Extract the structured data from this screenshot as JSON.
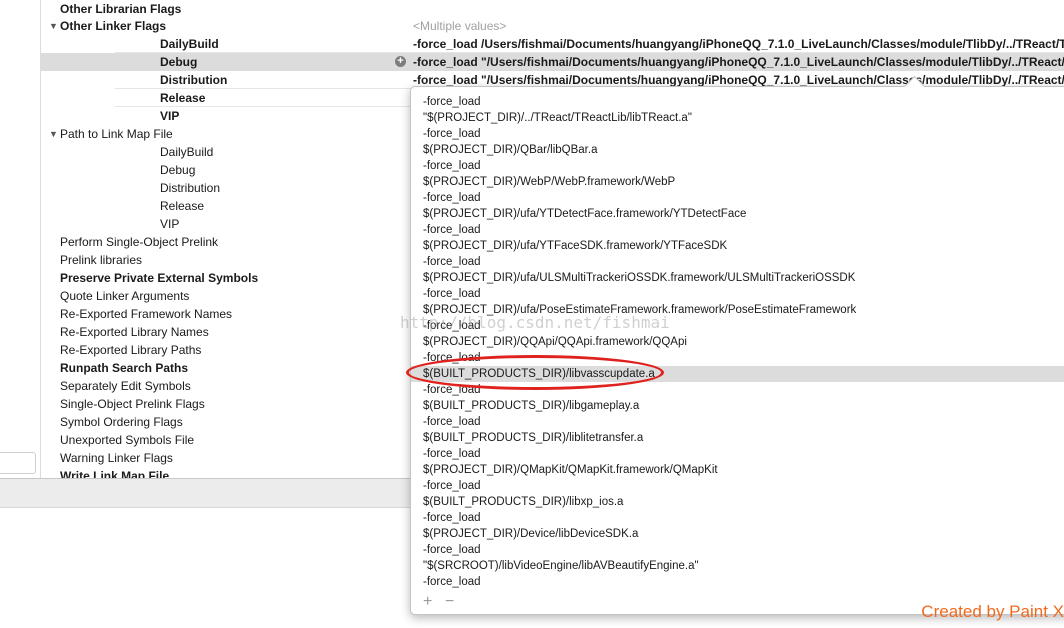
{
  "settings": {
    "other_librarian_flags": "Other Librarian Flags",
    "other_linker_flags": {
      "label": "Other Linker Flags",
      "value": "<Multiple values>",
      "configs": [
        {
          "name": "DailyBuild",
          "value": "-force_load /Users/fishmai/Documents/huangyang/iPhoneQQ_7.1.0_LiveLaunch/Classes/module/TlibDy/../TReact/TR"
        },
        {
          "name": "Debug",
          "value": "-force_load \"/Users/fishmai/Documents/huangyang/iPhoneQQ_7.1.0_LiveLaunch/Classes/module/TlibDy/../TReact/TR"
        },
        {
          "name": "Distribution",
          "value": "-force_load \"/Users/fishmai/Documents/huangyang/iPhoneQQ_7.1.0_LiveLaunch/Classes/module/TlibDy/../TReact/TR"
        },
        {
          "name": "Release",
          "value": ""
        },
        {
          "name": "VIP",
          "value": ""
        }
      ]
    },
    "path_to_link_map_file": {
      "label": "Path to Link Map File",
      "configs": [
        "DailyBuild",
        "Debug",
        "Distribution",
        "Release",
        "VIP"
      ]
    },
    "others": [
      {
        "label": "Perform Single-Object Prelink",
        "bold": false
      },
      {
        "label": "Prelink libraries",
        "bold": false
      },
      {
        "label": "Preserve Private External Symbols",
        "bold": true
      },
      {
        "label": "Quote Linker Arguments",
        "bold": false
      },
      {
        "label": "Re-Exported Framework Names",
        "bold": false
      },
      {
        "label": "Re-Exported Library Names",
        "bold": false
      },
      {
        "label": "Re-Exported Library Paths",
        "bold": false
      },
      {
        "label": "Runpath Search Paths",
        "bold": true
      },
      {
        "label": "Separately Edit Symbols",
        "bold": false
      },
      {
        "label": "Single-Object Prelink Flags",
        "bold": false
      },
      {
        "label": "Symbol Ordering Flags",
        "bold": false
      },
      {
        "label": "Unexported Symbols File",
        "bold": false
      },
      {
        "label": "Warning Linker Flags",
        "bold": false
      },
      {
        "label": "Write Link Map File",
        "bold": true
      }
    ]
  },
  "popover": {
    "entries": [
      "-force_load",
      "\"$(PROJECT_DIR)/../TReact/TReactLib/libTReact.a\"",
      "-force_load",
      "$(PROJECT_DIR)/QBar/libQBar.a",
      "-force_load",
      "$(PROJECT_DIR)/WebP/WebP.framework/WebP",
      "-force_load",
      "$(PROJECT_DIR)/ufa/YTDetectFace.framework/YTDetectFace",
      "-force_load",
      "$(PROJECT_DIR)/ufa/YTFaceSDK.framework/YTFaceSDK",
      "-force_load",
      "$(PROJECT_DIR)/ufa/ULSMultiTrackeriOSSDK.framework/ULSMultiTrackeriOSSDK",
      "-force_load",
      "$(PROJECT_DIR)/ufa/PoseEstimateFramework.framework/PoseEstimateFramework",
      "-force_load",
      "$(PROJECT_DIR)/QQApi/QQApi.framework/QQApi",
      "-force_load",
      "$(BUILT_PRODUCTS_DIR)/libvasscupdate.a",
      "-force_load",
      "$(BUILT_PRODUCTS_DIR)/libgameplay.a",
      "-force_load",
      "$(BUILT_PRODUCTS_DIR)/liblitetransfer.a",
      "-force_load",
      "$(PROJECT_DIR)/QMapKit/QMapKit.framework/QMapKit",
      "-force_load",
      "$(BUILT_PRODUCTS_DIR)/libxp_ios.a",
      "-force_load",
      "$(PROJECT_DIR)/Device/libDeviceSDK.a",
      "-force_load",
      "\"$(SRCROOT)/libVideoEngine/libAVBeautifyEngine.a\"",
      "-force_load"
    ],
    "selected_index": 17,
    "add_label": "+",
    "remove_label": "−"
  },
  "watermark": "http://blog.csdn.net/fishmai",
  "credit": "Created by Paint X"
}
